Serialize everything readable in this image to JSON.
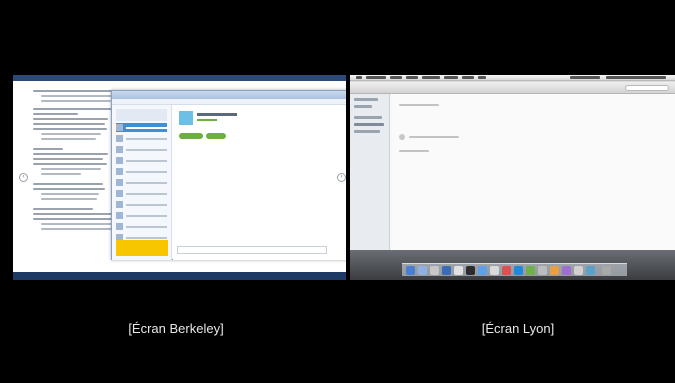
{
  "captions": {
    "left": "[Écran Berkeley]",
    "right": "[Écran Lyon]"
  },
  "nav": {
    "prev_icon": "chevron-left-icon",
    "next_icon": "chevron-right-icon",
    "prev_glyph": "‹",
    "next_glyph": "›"
  },
  "colors": {
    "background": "#000000",
    "caption_text": "#e9e9e9",
    "skype_blue": "#3d8fd6",
    "skype_green": "#6bb040",
    "skype_promo": "#f7c600",
    "windows_taskbar": "#1c3a63"
  }
}
